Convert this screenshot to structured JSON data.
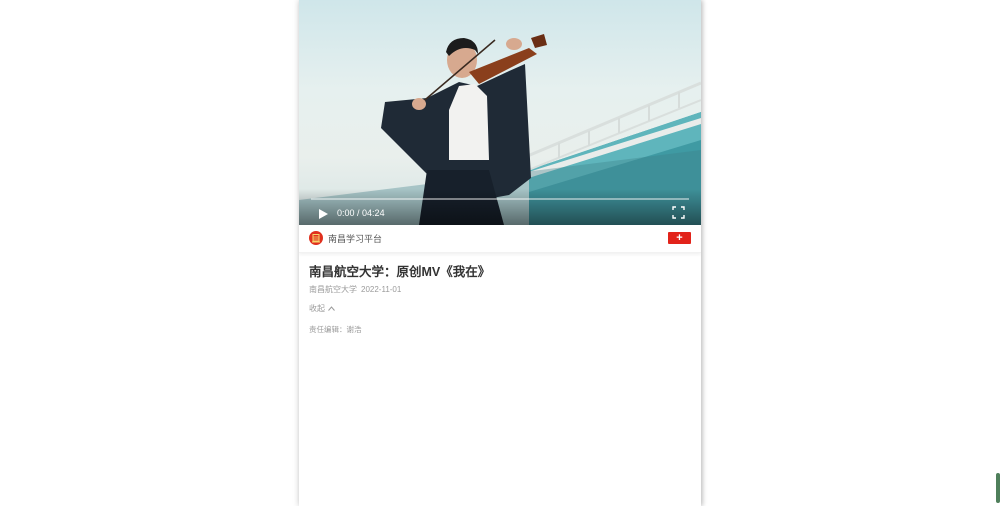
{
  "video": {
    "current_time": "0:00",
    "duration": "04:24",
    "progress": 0,
    "play_icon": "play-icon",
    "fullscreen_icon": "fullscreen-icon"
  },
  "publisher": {
    "name": "南昌学习平台",
    "follow_label": "+",
    "brand_color": "#e2231a"
  },
  "article": {
    "title": "南昌航空大学：原创MV《我在》",
    "source": "南昌航空大学",
    "date": "2022-11-01",
    "collapse_label": "收起",
    "collapse_icon": "chevron-up-icon",
    "editor": "责任编辑：谢浩"
  }
}
